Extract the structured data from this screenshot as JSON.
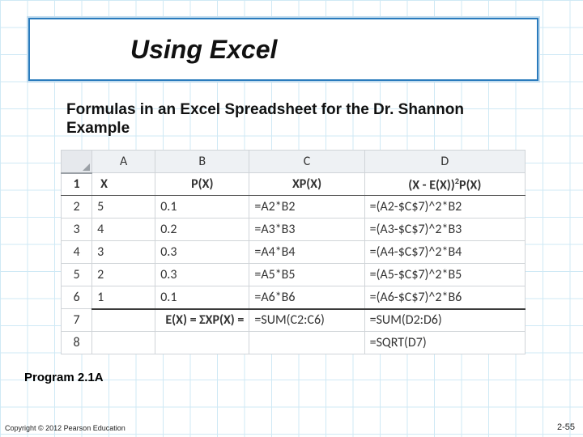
{
  "title": "Using Excel",
  "subhead": "Formulas in an Excel Spreadsheet for the Dr. Shannon Example",
  "columns": [
    "A",
    "B",
    "C",
    "D"
  ],
  "row_numbers": [
    "1",
    "2",
    "3",
    "4",
    "5",
    "6",
    "7",
    "8"
  ],
  "headers": {
    "A": "X",
    "B": "P(X)",
    "C": "XP(X)",
    "D_html": "(X - E(X))<sup>2</sup>P(X)"
  },
  "rows": [
    {
      "A": "5",
      "B": "0.1",
      "C": "=A2*B2",
      "D": "=(A2-$C$7)^2*B2"
    },
    {
      "A": "4",
      "B": "0.2",
      "C": "=A3*B3",
      "D": "=(A3-$C$7)^2*B3"
    },
    {
      "A": "3",
      "B": "0.3",
      "C": "=A4*B4",
      "D": "=(A4-$C$7)^2*B4"
    },
    {
      "A": "2",
      "B": "0.3",
      "C": "=A5*B5",
      "D": "=(A5-$C$7)^2*B5"
    },
    {
      "A": "1",
      "B": "0.1",
      "C": "=A6*B6",
      "D": "=(A6-$C$7)^2*B6"
    }
  ],
  "summary_row7": {
    "label": "E(X) =  ΣXP(X) = ",
    "C": "=SUM(C2:C6)",
    "D": "=SUM(D2:D6)"
  },
  "summary_row8": {
    "D": "=SQRT(D7)"
  },
  "caption": "Program 2.1A",
  "copyright": "Copyright © 2012 Pearson Education",
  "pagenum": "2-55",
  "chart_data": {
    "type": "table",
    "title": "Formulas in an Excel Spreadsheet for the Dr. Shannon Example",
    "columns": [
      "X",
      "P(X)",
      "XP(X)",
      "(X - E(X))^2 P(X)"
    ],
    "data": [
      [
        5,
        0.1,
        "=A2*B2",
        "=(A2-$C$7)^2*B2"
      ],
      [
        4,
        0.2,
        "=A3*B3",
        "=(A3-$C$7)^2*B3"
      ],
      [
        3,
        0.3,
        "=A4*B4",
        "=(A4-$C$7)^2*B4"
      ],
      [
        2,
        0.3,
        "=A5*B5",
        "=(A5-$C$7)^2*B5"
      ],
      [
        1,
        0.1,
        "=A6*B6",
        "=(A6-$C$7)^2*B6"
      ]
    ],
    "summaries": {
      "E(X) = ΣXP(X)": "=SUM(C2:C6)",
      "Variance": "=SUM(D2:D6)",
      "StdDev": "=SQRT(D7)"
    }
  }
}
